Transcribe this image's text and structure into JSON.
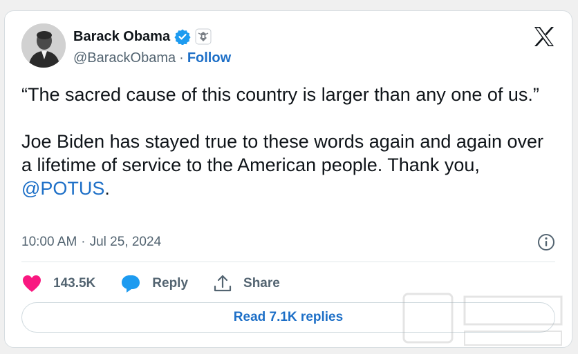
{
  "author": {
    "name": "Barack Obama",
    "handle": "@BarackObama",
    "separator": "·",
    "follow_label": "Follow",
    "verified_badge_color": "#1d9bf0",
    "avatar_icon": "profile-photo"
  },
  "brand": {
    "logo_icon": "x-logo",
    "logo_color": "#0f1419"
  },
  "tweet": {
    "text_quote": "“The sacred cause of this country is larger than any one of us.”\n\nJoe Biden has stayed true to these words again and again over a lifetime of service to the American people. Thank you, ",
    "mention": "@POTUS",
    "text_end": ".",
    "time": "10:00 AM",
    "meta_separator": "·",
    "date": "Jul 25, 2024"
  },
  "actions": {
    "likes": "143.5K",
    "reply_label": "Reply",
    "share_label": "Share",
    "like_color": "#f91880",
    "reply_icon_color": "#1d9bf0"
  },
  "replies": {
    "read_label": "Read 7.1K replies"
  },
  "colors": {
    "accent": "#1d6fc7",
    "muted": "#536471"
  }
}
